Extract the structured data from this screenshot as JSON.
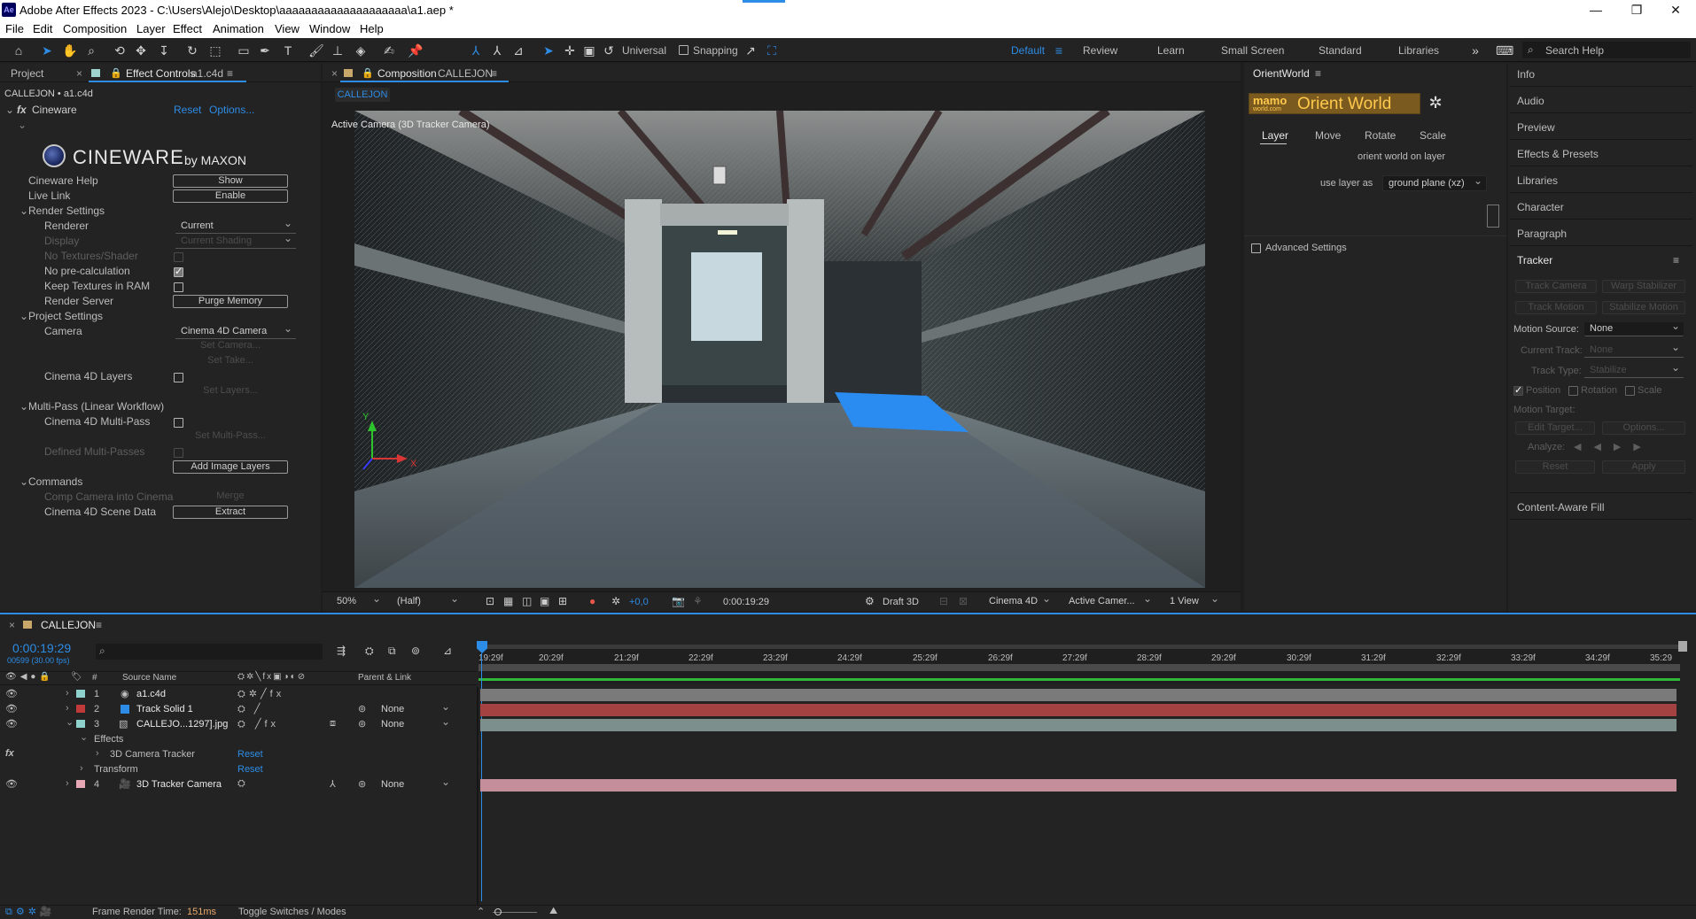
{
  "window": {
    "app_icon": "Ae",
    "title": "Adobe After Effects 2023 - C:\\Users\\Alejo\\Desktop\\aaaaaaaaaaaaaaaaaaaa\\a1.aep *"
  },
  "menu": [
    "File",
    "Edit",
    "Composition",
    "Layer",
    "Effect",
    "Animation",
    "View",
    "Window",
    "Help"
  ],
  "toolbar": {
    "axis_mode": "Universal",
    "snapping": "Snapping",
    "workspaces": [
      "Default",
      "Review",
      "Learn",
      "Small Screen",
      "Standard",
      "Libraries"
    ],
    "active_workspace": "Default",
    "search_placeholder": "Search Help"
  },
  "left_panel": {
    "tab_project": "Project",
    "tab_effect_controls": "Effect Controls",
    "tab_effect_layer": "a1.c4d",
    "header": "CALLEJON • a1.c4d",
    "effect_name": "Cineware",
    "effect_reset": "Reset",
    "effect_options": "Options...",
    "logo_text": "CINEWARE",
    "logo_by": "by MAXON",
    "rows": {
      "help": "Cineware Help",
      "help_btn": "Show",
      "live": "Live Link",
      "live_btn": "Enable",
      "render_settings": "Render Settings",
      "renderer": "Renderer",
      "renderer_val": "Current",
      "display": "Display",
      "display_val": "Current Shading",
      "no_textures": "No Textures/Shader",
      "no_precalc": "No pre-calculation",
      "keep_textures": "Keep Textures in RAM",
      "render_server": "Render Server",
      "purge": "Purge Memory",
      "project_settings": "Project Settings",
      "camera": "Camera",
      "camera_val": "Cinema 4D Camera",
      "set_camera": "Set Camera...",
      "set_take": "Set Take...",
      "c4d_layers": "Cinema 4D Layers",
      "set_layers": "Set Layers...",
      "multipass": "Multi-Pass (Linear Workflow)",
      "c4d_multipass": "Cinema 4D Multi-Pass",
      "set_multipass": "Set Multi-Pass...",
      "defined_multipasses": "Defined Multi-Passes",
      "add_image_layers": "Add Image Layers",
      "commands": "Commands",
      "comp_camera": "Comp Camera into Cinema",
      "merge": "Merge",
      "scene_data": "Cinema 4D Scene Data",
      "extract": "Extract"
    }
  },
  "composition": {
    "tab_label": "Composition",
    "tab_comp": "CALLEJON",
    "sub_tab": "CALLEJON",
    "view_label": "Active Camera (3D Tracker Camera)",
    "axis_y": "Y",
    "axis_x": "X",
    "footer": {
      "zoom": "50%",
      "resolution": "(Half)",
      "exposure": "+0,0",
      "timecode": "0:00:19:29",
      "draft": "Draft 3D",
      "renderer": "Cinema 4D",
      "camera": "Active Camer...",
      "views": "1 View"
    },
    "colors": {
      "plane": "#2a8cf0"
    }
  },
  "orient_world": {
    "tab": "OrientWorld",
    "logo_brand": "mamo",
    "logo_sub": "world.com",
    "logo_title": "Orient World",
    "tabs": [
      "Layer",
      "Move",
      "Rotate",
      "Scale"
    ],
    "active_tab": "Layer",
    "caption": "orient world on layer",
    "use_layer_label": "use layer as",
    "use_layer_value": "ground plane (xz)",
    "advanced": "Advanced Settings"
  },
  "right_panel": {
    "items": [
      "Info",
      "Audio",
      "Preview",
      "Effects & Presets",
      "Libraries",
      "Character",
      "Paragraph"
    ],
    "tracker_title": "Tracker",
    "track_camera": "Track Camera",
    "warp_stabilizer": "Warp Stabilizer",
    "track_motion": "Track Motion",
    "stabilize_motion": "Stabilize Motion",
    "motion_source_label": "Motion Source:",
    "motion_source_value": "None",
    "current_track_label": "Current Track:",
    "current_track_value": "None",
    "track_type_label": "Track Type:",
    "track_type_value": "Stabilize",
    "position": "Position",
    "rotation": "Rotation",
    "scale": "Scale",
    "motion_target": "Motion Target:",
    "edit_target": "Edit Target...",
    "options": "Options...",
    "analyze": "Analyze:",
    "reset": "Reset",
    "apply": "Apply",
    "content_aware": "Content-Aware Fill"
  },
  "timeline": {
    "tab": "CALLEJON",
    "timecode": "0:00:19:29",
    "frame_info": "00599 (30.00 fps)",
    "col_num": "#",
    "col_source": "Source Name",
    "col_parent": "Parent & Link",
    "ruler": [
      "19:29f",
      "20:29f",
      "21:29f",
      "22:29f",
      "23:29f",
      "24:29f",
      "25:29f",
      "26:29f",
      "27:29f",
      "28:29f",
      "29:29f",
      "30:29f",
      "31:29f",
      "32:29f",
      "33:29f",
      "34:29f",
      "35:29"
    ],
    "layers": [
      {
        "num": "1",
        "name": "a1.c4d",
        "label_color": "#8fd1cc",
        "bar_color": "#7a7a7a",
        "parent": ""
      },
      {
        "num": "2",
        "name": "Track Solid 1",
        "label_color": "#c03a3a",
        "bar_color": "#a44242",
        "parent": "None"
      },
      {
        "num": "3",
        "name": "CALLEJO...1297].jpg",
        "label_color": "#8fd1cc",
        "bar_color": "#7d8f8c",
        "parent": "None"
      },
      {
        "num": "4",
        "name": "3D Tracker Camera",
        "label_color": "#e8a7b4",
        "bar_color": "#c48e9a",
        "parent": "None"
      }
    ],
    "effects_label": "Effects",
    "camera_tracker": "3D Camera Tracker",
    "camera_tracker_reset": "Reset",
    "transform": "Transform",
    "transform_reset": "Reset",
    "status_render_label": "Frame Render Time:",
    "status_render_value": "151ms",
    "status_toggle": "Toggle Switches / Modes"
  }
}
